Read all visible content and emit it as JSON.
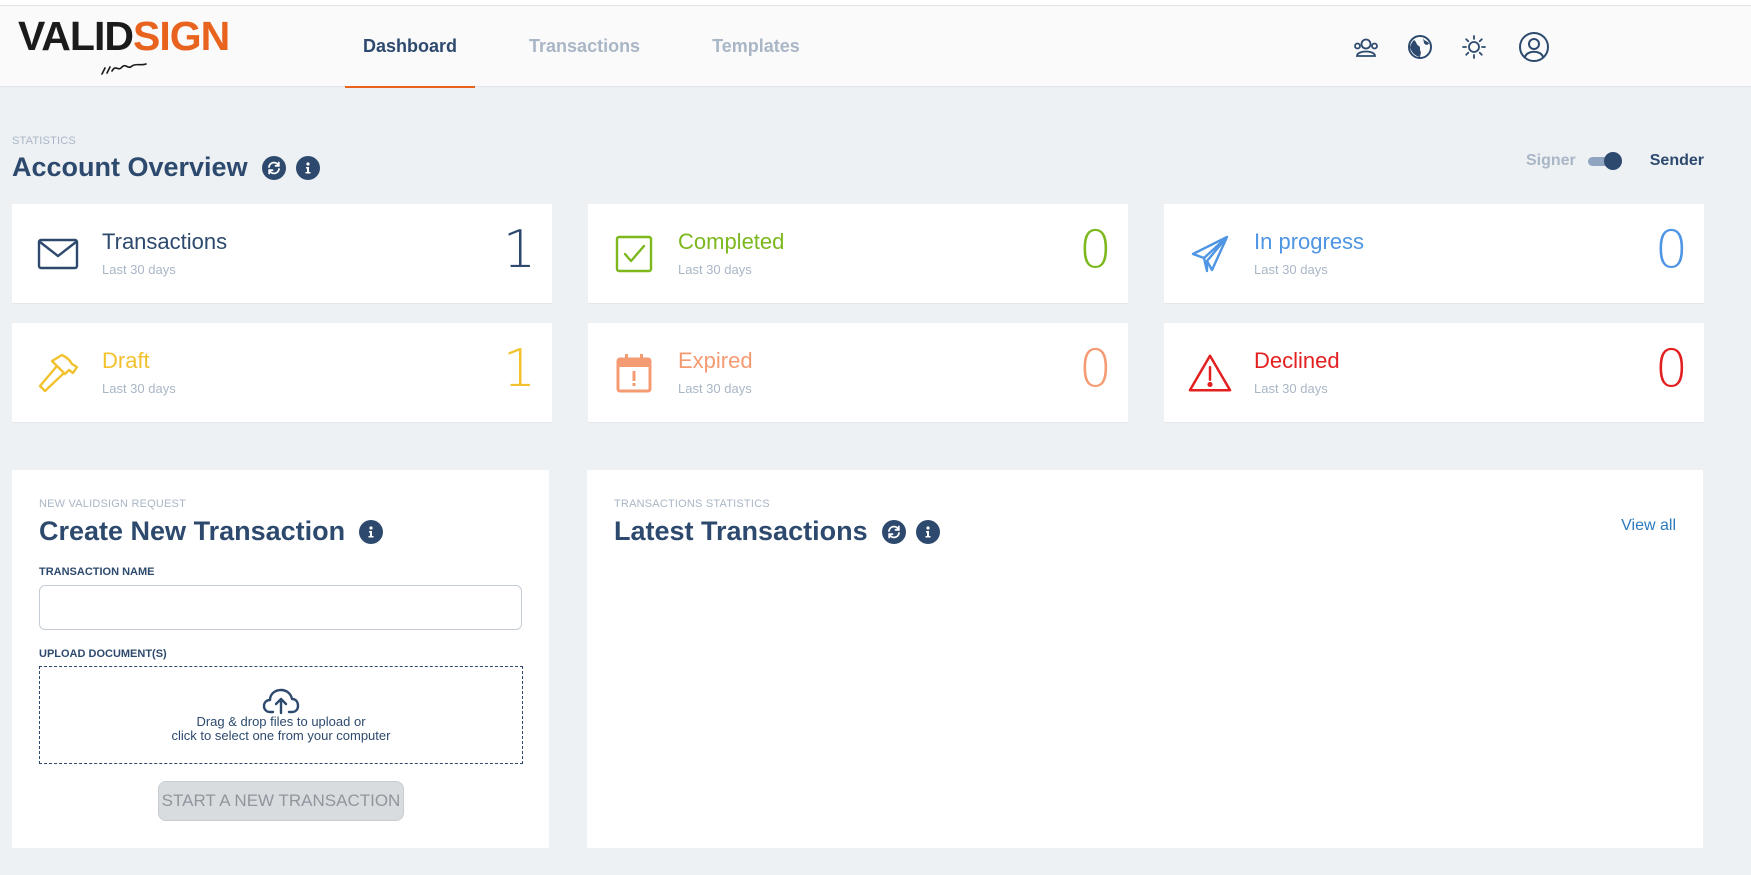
{
  "brand": {
    "logo_part1": "VALID",
    "logo_part2": "SIGN",
    "accent": "#e8641e",
    "primary": "#2d4a6e"
  },
  "nav": {
    "items": [
      {
        "label": "Dashboard",
        "active": true
      },
      {
        "label": "Transactions",
        "active": false
      },
      {
        "label": "Templates",
        "active": false
      }
    ]
  },
  "header_icons": [
    "contacts-icon",
    "globe-icon",
    "theme-sun-icon",
    "user-account-icon"
  ],
  "overview": {
    "eyebrow": "STATISTICS",
    "title": "Account Overview",
    "toggle": {
      "left_label": "Signer",
      "right_label": "Sender",
      "selected": "Sender"
    }
  },
  "stats": [
    {
      "label": "Transactions",
      "sub": "Last 30 days",
      "value": "1",
      "color": "#2d4a6e",
      "icon": "envelope-icon"
    },
    {
      "label": "Completed",
      "sub": "Last 30 days",
      "value": "0",
      "color": "#7cb81e",
      "icon": "checkbox-icon"
    },
    {
      "label": "In progress",
      "sub": "Last 30 days",
      "value": "0",
      "color": "#4e95e3",
      "icon": "paper-plane-icon"
    },
    {
      "label": "Draft",
      "sub": "Last 30 days",
      "value": "1",
      "color": "#f2c12e",
      "icon": "hammer-icon"
    },
    {
      "label": "Expired",
      "sub": "Last 30 days",
      "value": "0",
      "color": "#f59b73",
      "icon": "calendar-alert-icon"
    },
    {
      "label": "Declined",
      "sub": "Last 30 days",
      "value": "0",
      "color": "#e31f1f",
      "icon": "warning-icon"
    }
  ],
  "create": {
    "eyebrow": "NEW VALIDSIGN REQUEST",
    "title": "Create New Transaction",
    "name_label": "TRANSACTION NAME",
    "name_value": "",
    "upload_label": "UPLOAD DOCUMENT(S)",
    "dropzone_line1": "Drag & drop files to upload or",
    "dropzone_line2": "click to select one from your computer",
    "start_button": "START A NEW TRANSACTION"
  },
  "latest": {
    "eyebrow": "TRANSACTIONS STATISTICS",
    "title": "Latest Transactions",
    "view_all": "View all"
  }
}
